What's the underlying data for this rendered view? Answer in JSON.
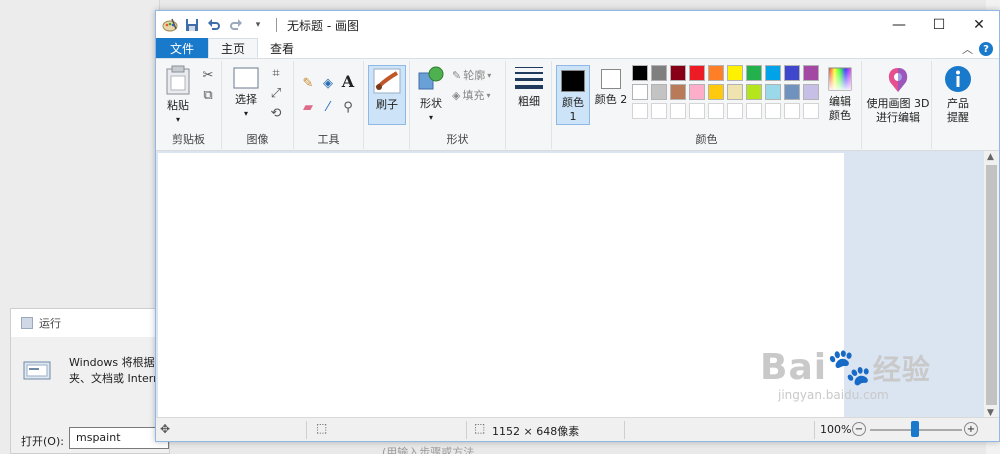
{
  "run_dialog": {
    "title": "运行",
    "description_line1": "Windows 将根据你",
    "description_line2": "夹、文档或 Intern",
    "open_label": "打开(O):",
    "input_value": "mspaint"
  },
  "background": {
    "bottom_hint": "(用输入步骤或方法"
  },
  "paint": {
    "title": "无标题 - 画图",
    "tabs": {
      "file": "文件",
      "home": "主页",
      "view": "查看"
    },
    "groups": {
      "clipboard": "剪贴板",
      "image": "图像",
      "tools": "工具",
      "shapes": "形状",
      "colors": "颜色"
    },
    "buttons": {
      "paste": "粘贴",
      "select": "选择",
      "brushes": "刷子",
      "shapes": "形状",
      "outline": "轮廓",
      "fill": "填充",
      "size": "粗细",
      "color1": "颜色 1",
      "color2": "颜色 2",
      "edit_colors": "编辑颜色",
      "paint3d": "使用画图 3D 进行编辑",
      "product_alert": "产品提醒"
    },
    "palette_row1": [
      "#000000",
      "#7f7f7f",
      "#880015",
      "#ed1c24",
      "#ff7f27",
      "#fff200",
      "#22b14c",
      "#00a2e8",
      "#3f48cc",
      "#a349a4"
    ],
    "palette_row2": [
      "#ffffff",
      "#c3c3c3",
      "#b97a57",
      "#ffaec9",
      "#ffc90e",
      "#efe4b0",
      "#b5e61d",
      "#99d9ea",
      "#7092be",
      "#c8bfe7"
    ],
    "status": {
      "dimensions": "1152 × 648像素",
      "zoom": "100%"
    }
  },
  "watermark": {
    "brand": "Bai",
    "brand2": "经验",
    "url": "jingyan.baidu.com"
  }
}
